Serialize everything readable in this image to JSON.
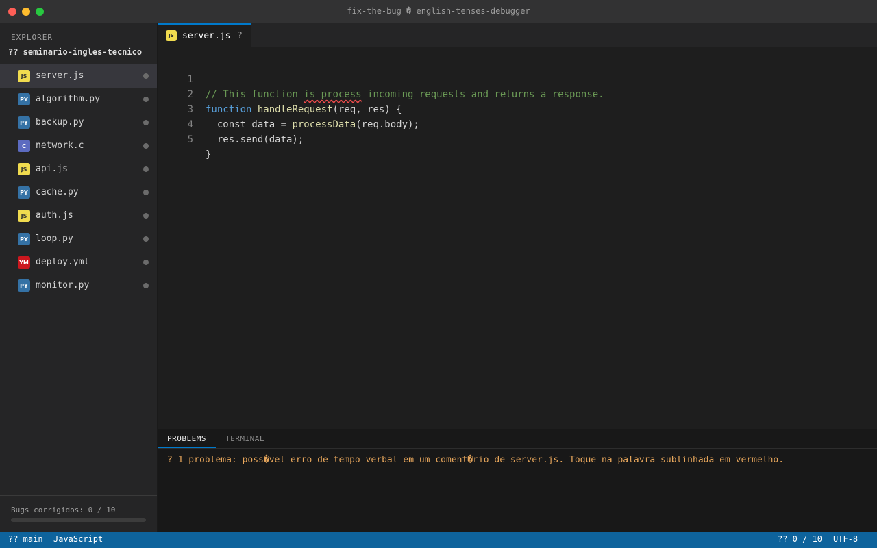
{
  "window": {
    "title": "fix-the-bug � english-tenses-debugger"
  },
  "sidebar": {
    "heading": "EXPLORER",
    "project": "?? seminario-ingles-tecnico",
    "files": [
      {
        "badge": "JS",
        "name": "server.js"
      },
      {
        "badge": "PY",
        "name": "algorithm.py"
      },
      {
        "badge": "PY",
        "name": "backup.py"
      },
      {
        "badge": "C",
        "name": "network.c"
      },
      {
        "badge": "JS",
        "name": "api.js"
      },
      {
        "badge": "PY",
        "name": "cache.py"
      },
      {
        "badge": "JS",
        "name": "auth.js"
      },
      {
        "badge": "PY",
        "name": "loop.py"
      },
      {
        "badge": "YM",
        "name": "deploy.yml"
      },
      {
        "badge": "PY",
        "name": "monitor.py"
      }
    ],
    "progress_label": "Bugs corrigidos: 0 / 10",
    "progress_fraction": 0
  },
  "editor": {
    "tab": {
      "badge": "JS",
      "name": "server.js",
      "mark": "?"
    },
    "line_numbers": [
      "1",
      "2",
      "3",
      "4",
      "5"
    ],
    "lines": {
      "l1_a": "// This function ",
      "l1_err": "is process",
      "l1_b": " incoming requests and returns a response.",
      "l2_kw": "function",
      "l2_sp": " ",
      "l2_fn": "handleRequest",
      "l2_rest": "(req, res) {",
      "l3_a": "  const data = ",
      "l3_fn": "processData",
      "l3_b": "(req.body);",
      "l4": "  res.send(data);",
      "l5": "}"
    }
  },
  "panel": {
    "tabs": [
      "PROBLEMS",
      "TERMINAL"
    ],
    "problem": "? 1 problema: poss�vel erro de tempo verbal em um coment�rio de server.js. Toque na palavra sublinhada em vermelho."
  },
  "statusbar": {
    "branch": "?? main",
    "language": "JavaScript",
    "score": "?? 0 / 10",
    "encoding": "UTF-8"
  },
  "colors": {
    "accent": "#007acc",
    "statusbar": "#0e639c",
    "js_badge": "#f0db4f",
    "py_badge": "#3572a5",
    "c_badge": "#5c6bc0",
    "yml_badge": "#cb171e",
    "problem_text": "#e5a55b",
    "squiggle": "#f14c4c"
  }
}
